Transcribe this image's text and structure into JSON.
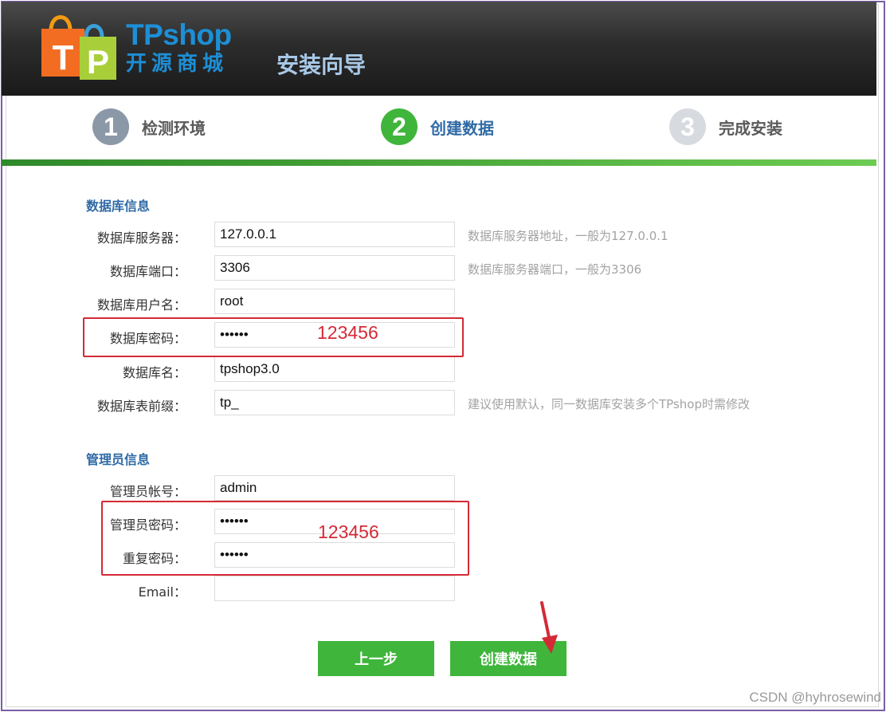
{
  "brand": {
    "name_en": "TPshop",
    "name_cn": "开源商城",
    "logo_letters": [
      "T",
      "P"
    ]
  },
  "header": {
    "title": "安装向导"
  },
  "steps": [
    {
      "number": "1",
      "label": "检测环境",
      "state": "done"
    },
    {
      "number": "2",
      "label": "创建数据",
      "state": "active"
    },
    {
      "number": "3",
      "label": "完成安装",
      "state": "pending"
    }
  ],
  "db_section": {
    "title": "数据库信息",
    "fields": [
      {
        "label": "数据库服务器：",
        "value": "127.0.0.1",
        "hint": "数据库服务器地址，一般为127.0.0.1"
      },
      {
        "label": "数据库端口：",
        "value": "3306",
        "hint": "数据库服务器端口，一般为3306"
      },
      {
        "label": "数据库用户名：",
        "value": "root",
        "hint": ""
      },
      {
        "label": "数据库密码：",
        "value": "123456",
        "hint": ""
      },
      {
        "label": "数据库名：",
        "value": "tpshop3.0",
        "hint": ""
      },
      {
        "label": "数据库表前缀：",
        "value": "tp_",
        "hint": "建议使用默认，同一数据库安装多个TPshop时需修改"
      }
    ]
  },
  "admin_section": {
    "title": "管理员信息",
    "fields": [
      {
        "label": "管理员帐号：",
        "value": "admin"
      },
      {
        "label": "管理员密码：",
        "value": "123456"
      },
      {
        "label": "重复密码：",
        "value": "123456"
      },
      {
        "label": "Email：",
        "value": ""
      }
    ]
  },
  "annotations": {
    "db_password": "123456",
    "admin_password": "123456"
  },
  "buttons": {
    "prev": "上一步",
    "create": "创建数据"
  },
  "watermark": "CSDN @hyhrosewind",
  "colors": {
    "accent_green": "#3fb53b",
    "brand_blue": "#1d8fd6",
    "section_blue": "#2f6aa5",
    "annotation_red": "#d42a36"
  }
}
